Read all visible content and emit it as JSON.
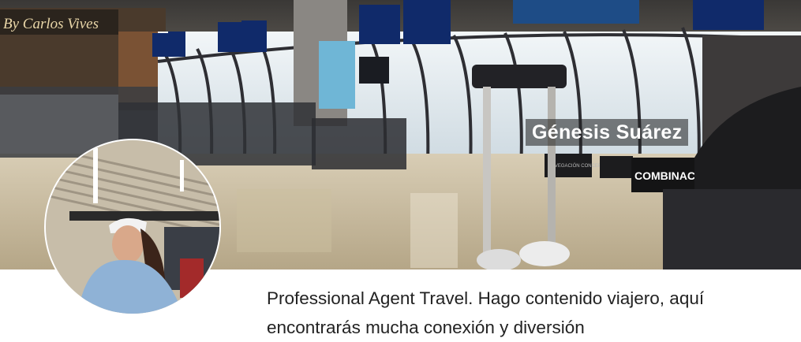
{
  "profile": {
    "name": "Génesis Suárez",
    "bio": "Professional Agent Travel. Hago contenido viajero, aquí encontrarás mucha conexión y diversión",
    "cover_sign_text": "By Carlos Vives",
    "banner_text": "COMBINACIÓ",
    "small_banner_text": "NAVEGACIÓN CONCEPTOS"
  },
  "colors": {
    "floor": "#c9bba0",
    "glass": "#dfe8ee",
    "text": "#222222"
  }
}
